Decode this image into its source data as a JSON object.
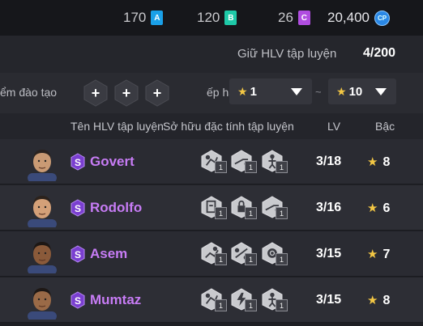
{
  "currencies": [
    {
      "value": "170",
      "tag": "A",
      "color": "#1aa0e8"
    },
    {
      "value": "120",
      "tag": "B",
      "color": "#1ec9a8"
    },
    {
      "value": "26",
      "tag": "C",
      "color": "#b04de0"
    }
  ],
  "coins": {
    "value": "20,400",
    "tag": "CP"
  },
  "hlv": {
    "label": "Giữ HLV tập luyện",
    "count": "4/200"
  },
  "filters": {
    "slot_label": "ểm đào tạo",
    "rank_label": "ếp hạ",
    "add_symbol": "+",
    "min_rank": "1",
    "max_rank": "10",
    "tilde": "~"
  },
  "columns": {
    "name": "Tên HLV tập luyện",
    "traits": "Sở hữu đặc tính tập luyện",
    "lv": "LV",
    "grade": "Bậc"
  },
  "coaches": [
    {
      "badge": "S",
      "name": "Govert",
      "lv": "3/18",
      "grade": "8",
      "skill_levels": [
        "1",
        "1",
        "1"
      ],
      "skill_icons": [
        "dribble-icon",
        "shooting-icon",
        "header-icon"
      ]
    },
    {
      "badge": "S",
      "name": "Rodolfo",
      "lv": "3/16",
      "grade": "6",
      "skill_levels": [
        "1",
        "1",
        "1"
      ],
      "skill_icons": [
        "card-icon",
        "lock-icon",
        "shooting-icon"
      ]
    },
    {
      "badge": "S",
      "name": "Asem",
      "lv": "3/15",
      "grade": "7",
      "skill_levels": [
        "1",
        "1",
        "1"
      ],
      "skill_icons": [
        "tackle-icon",
        "pass-icon",
        "gear-icon"
      ]
    },
    {
      "badge": "S",
      "name": "Mumtaz",
      "lv": "3/15",
      "grade": "8",
      "skill_levels": [
        "1",
        "1",
        "1"
      ],
      "skill_icons": [
        "dribble-icon",
        "stamina-icon",
        "header-icon"
      ]
    }
  ]
}
